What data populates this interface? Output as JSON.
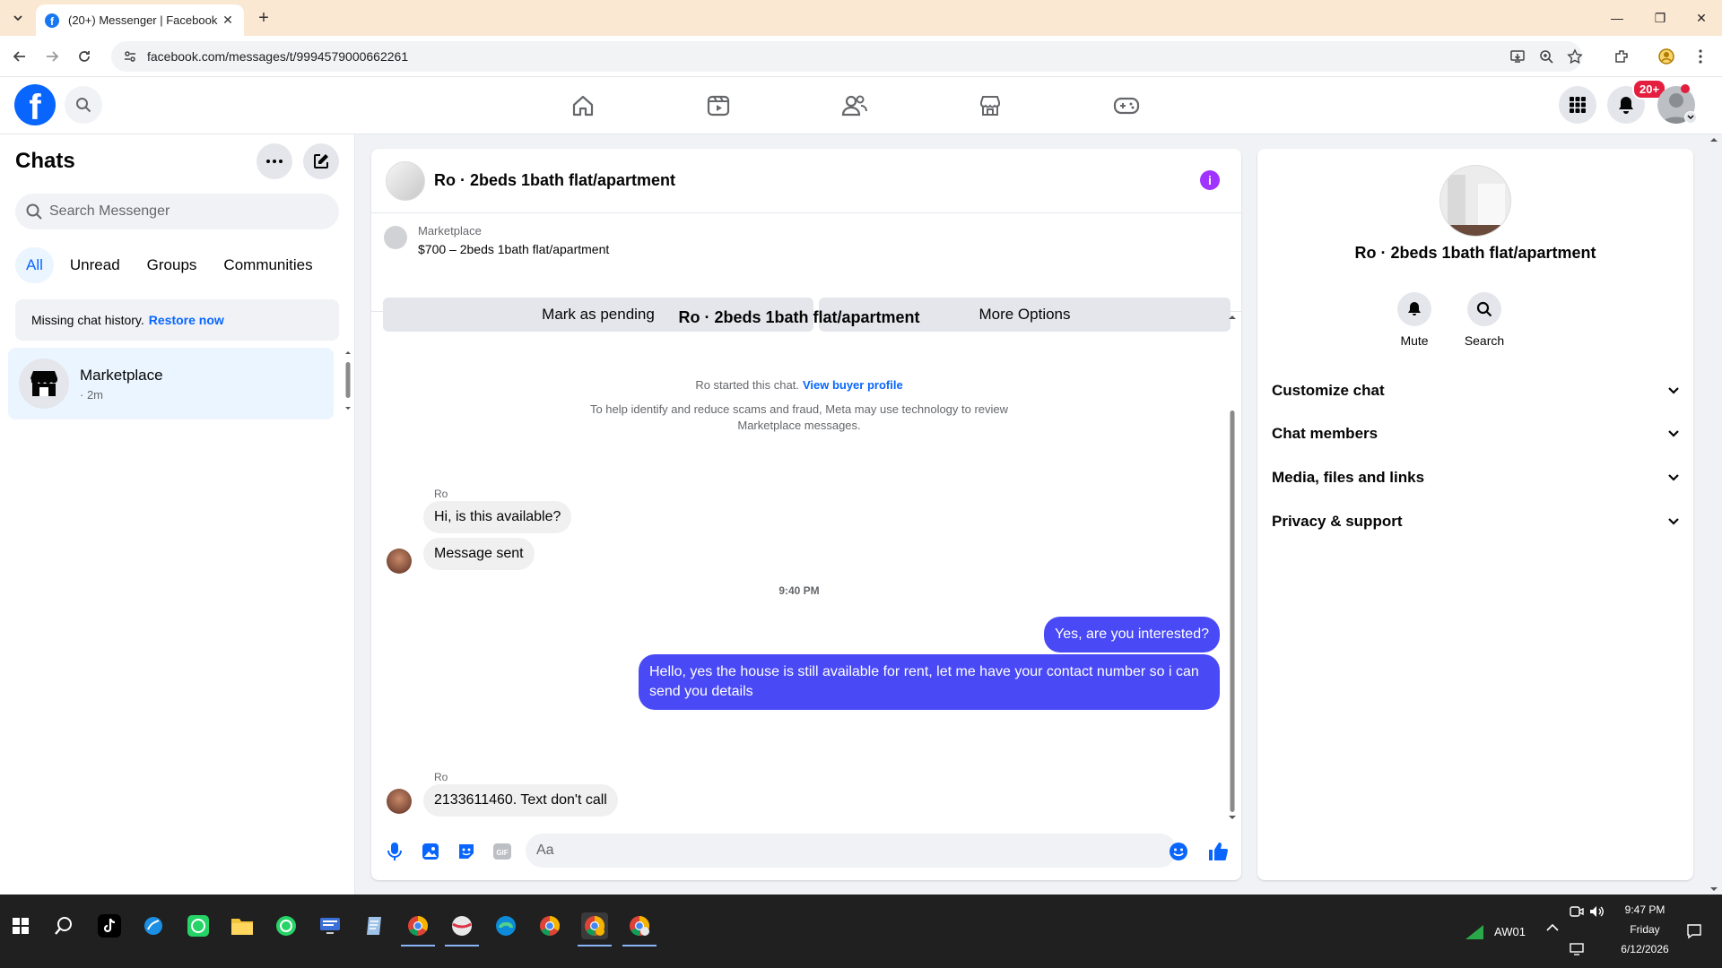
{
  "browser": {
    "tab_title": "(20+) Messenger | Facebook",
    "url": "facebook.com/messages/t/9994579000662261"
  },
  "header": {
    "notification_badge": "20+"
  },
  "sidebar": {
    "title": "Chats",
    "search_placeholder": "Search Messenger",
    "filters": [
      "All",
      "Unread",
      "Groups",
      "Communities"
    ],
    "notice_text": "Missing chat history.",
    "notice_link": "Restore now",
    "chats": [
      {
        "name": "Marketplace",
        "sub": "· 2m"
      }
    ]
  },
  "conversation": {
    "title": "Ro · 2beds 1bath flat/apartment",
    "marketplace_label": "Marketplace",
    "listing": "$700 – 2beds 1bath flat/apartment",
    "btn_pending": "Mark as pending",
    "btn_more": "More Options",
    "thread_title": "Ro · 2beds 1bath flat/apartment",
    "started_text": "Ro started this chat.",
    "started_link": "View buyer profile",
    "warning": "To help identify and reduce scams and fraud, Meta may use technology to review Marketplace messages.",
    "messages": [
      {
        "sender": "Ro",
        "text": "Hi, is this available?"
      },
      {
        "text": "Message sent"
      },
      {
        "time": "9:40 PM"
      },
      {
        "text": "Yes, are you interested?"
      },
      {
        "text": "Hello, yes the house is still available for rent, let me have your contact number so i can send you details"
      },
      {
        "sender": "Ro",
        "text": "2133611460. Text don't call"
      }
    ],
    "composer_placeholder": "Aa"
  },
  "right_panel": {
    "name": "Ro · 2beds 1bath flat/apartment",
    "actions": [
      "Mute",
      "Search"
    ],
    "sections": [
      "Customize chat",
      "Chat members",
      "Media, files and links",
      "Privacy & support"
    ]
  },
  "taskbar": {
    "network": "AW01",
    "time": "9:47 PM",
    "day": "Friday",
    "date": "6/12/2026"
  },
  "colors": {
    "accent": "#0866ff",
    "outgoing_bubble": "#4949f5",
    "badge": "#e41e3f",
    "info": "#a033ff"
  }
}
